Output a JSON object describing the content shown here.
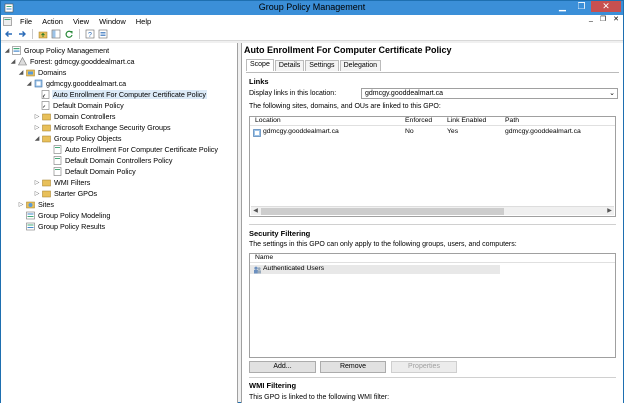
{
  "window": {
    "title": "Group Policy Management",
    "min_glyph": "▁",
    "max_glyph": "❐",
    "close_glyph": "✕"
  },
  "menu": [
    "File",
    "Action",
    "View",
    "Window",
    "Help"
  ],
  "menu_controls": {
    "min": "_",
    "restore": "❐",
    "close": "✕"
  },
  "tree": {
    "root": "Group Policy Management",
    "forest": "Forest: gdmcgy.gooddealmart.ca",
    "domains": "Domains",
    "domain": "gdmcgy.gooddealmart.ca",
    "auto_enroll_link": "Auto Enrollment For Computer Certificate Policy",
    "default_domain_policy": "Default Domain Policy",
    "domain_controllers": "Domain Controllers",
    "exchange_groups": "Microsoft Exchange Security Groups",
    "gpo_folder": "Group Policy Objects",
    "gpo_auto_enroll": "Auto Enrollment For Computer Certificate Policy",
    "gpo_default_dc": "Default Domain Controllers Policy",
    "gpo_default_domain": "Default Domain Policy",
    "wmi_filters": "WMI Filters",
    "starter_gpos": "Starter GPOs",
    "sites": "Sites",
    "modeling": "Group Policy Modeling",
    "results": "Group Policy Results"
  },
  "right": {
    "title": "Auto Enrollment For Computer Certificate Policy",
    "tabs": [
      "Scope",
      "Details",
      "Settings",
      "Delegation"
    ],
    "active_tab": "Scope",
    "links": {
      "heading": "Links",
      "display_label": "Display links in this location:",
      "display_value": "gdmcgy.gooddealmart.ca",
      "linked_text": "The following sites, domains, and OUs are linked to this GPO:",
      "columns": [
        "Location",
        "Enforced",
        "Link Enabled",
        "Path"
      ],
      "rows": [
        {
          "location": "gdmcgy.gooddealmart.ca",
          "enforced": "No",
          "link_enabled": "Yes",
          "path": "gdmcgy.gooddealmart.ca"
        }
      ]
    },
    "security": {
      "heading": "Security Filtering",
      "text": "The settings in this GPO can only apply to the following groups, users, and computers:",
      "column": "Name",
      "rows": [
        "Authenticated Users"
      ],
      "add": "Add...",
      "remove": "Remove",
      "properties": "Properties"
    },
    "wmi": {
      "heading": "WMI Filtering",
      "text": "This GPO is linked to the following WMI filter:"
    }
  }
}
